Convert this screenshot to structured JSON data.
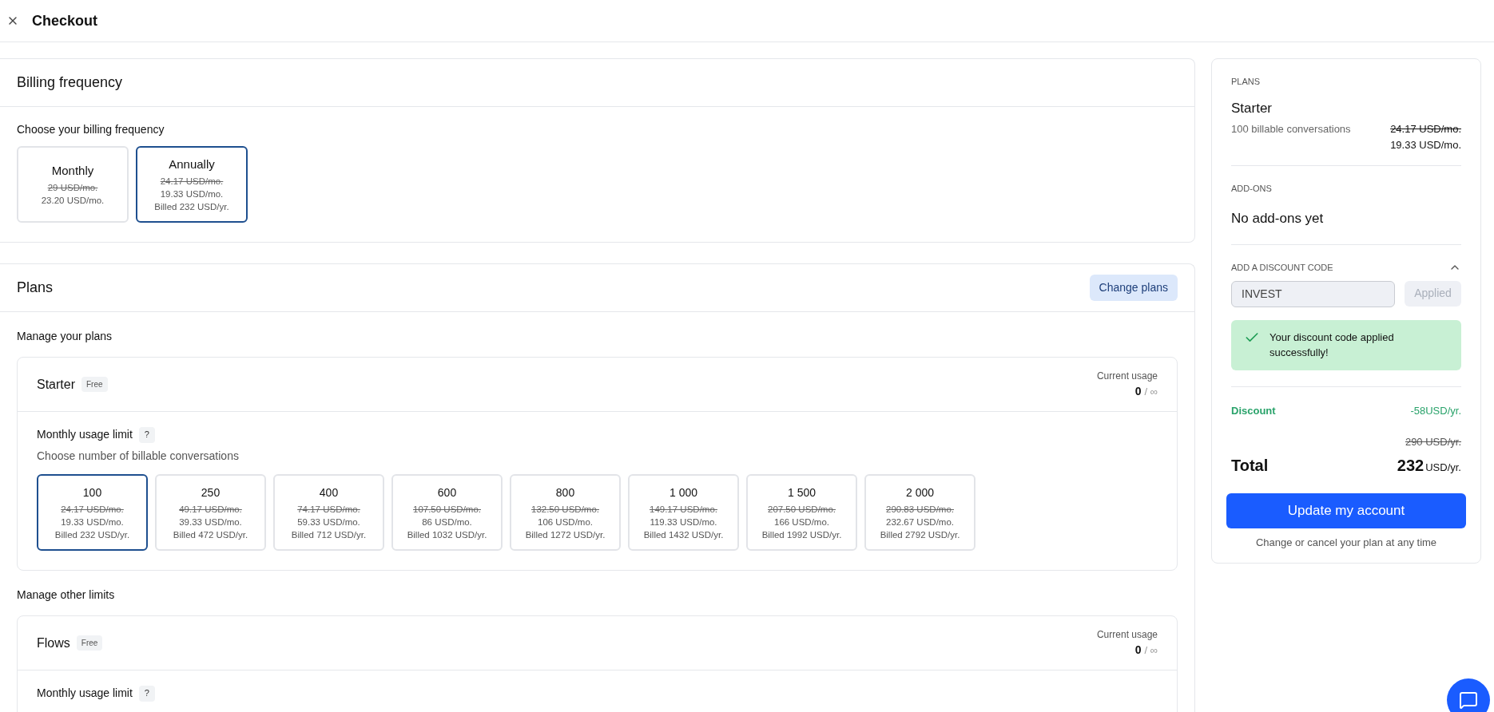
{
  "header": {
    "title": "Checkout"
  },
  "billing": {
    "title": "Billing frequency",
    "prompt": "Choose your billing frequency",
    "options": [
      {
        "label": "Monthly",
        "old": "29 USD/mo.",
        "price": "23.20 USD/mo.",
        "selected": false
      },
      {
        "label": "Annually",
        "old": "24.17 USD/mo.",
        "price": "19.33 USD/mo.",
        "billed": "Billed 232 USD/yr.",
        "selected": true
      }
    ]
  },
  "plans": {
    "title": "Plans",
    "action": "Change plans",
    "sections": [
      {
        "heading": "Manage your plans",
        "items": [
          {
            "name": "Starter",
            "badge": "Free",
            "usage_label": "Current usage",
            "usage_value": "0",
            "usage_max": "/ ∞",
            "limit_label": "Monthly usage limit",
            "help": "?",
            "hint": "Choose number of billable conversations",
            "options": [
              {
                "label": "100",
                "old": "24.17 USD/mo.",
                "price": "19.33 USD/mo.",
                "billed": "Billed 232 USD/yr.",
                "selected": true
              },
              {
                "label": "250",
                "old": "49.17 USD/mo.",
                "price": "39.33 USD/mo.",
                "billed": "Billed 472 USD/yr.",
                "selected": false
              },
              {
                "label": "400",
                "old": "74.17 USD/mo.",
                "price": "59.33 USD/mo.",
                "billed": "Billed 712 USD/yr.",
                "selected": false
              },
              {
                "label": "600",
                "old": "107.50 USD/mo.",
                "price": "86 USD/mo.",
                "billed": "Billed 1032 USD/yr.",
                "selected": false
              },
              {
                "label": "800",
                "old": "132.50 USD/mo.",
                "price": "106 USD/mo.",
                "billed": "Billed 1272 USD/yr.",
                "selected": false
              },
              {
                "label": "1 000",
                "old": "149.17 USD/mo.",
                "price": "119.33 USD/mo.",
                "billed": "Billed 1432 USD/yr.",
                "selected": false
              },
              {
                "label": "1 500",
                "old": "207.50 USD/mo.",
                "price": "166 USD/mo.",
                "billed": "Billed 1992 USD/yr.",
                "selected": false
              },
              {
                "label": "2 000",
                "old": "290.83 USD/mo.",
                "price": "232.67 USD/mo.",
                "billed": "Billed 2792 USD/yr.",
                "selected": false
              }
            ]
          }
        ]
      },
      {
        "heading": "Manage other limits",
        "items": [
          {
            "name": "Flows",
            "badge": "Free",
            "usage_label": "Current usage",
            "usage_value": "0",
            "usage_max": "/ ∞",
            "limit_label": "Monthly usage limit",
            "help": "?"
          }
        ]
      }
    ]
  },
  "summary": {
    "plans_label": "PLANS",
    "plan_name": "Starter",
    "plan_desc": "100 billable conversations",
    "plan_old": "24.17 USD/mo.",
    "plan_price": "19.33 USD/mo.",
    "addons_label": "ADD-ONS",
    "addons_text": "No add-ons yet",
    "discount_label": "ADD A DISCOUNT CODE",
    "discount_expanded": true,
    "code": "INVEST",
    "apply": "Applied",
    "apply_disabled": true,
    "success": "Your discount code applied successfully!",
    "discount_name": "Discount",
    "discount_value": "-58USD/yr.",
    "total_old": "290 USD/yr.",
    "total_label": "Total",
    "total_amount": "232",
    "total_unit": "USD/yr.",
    "submit": "Update my account",
    "note": "Change or cancel your plan at any time"
  }
}
